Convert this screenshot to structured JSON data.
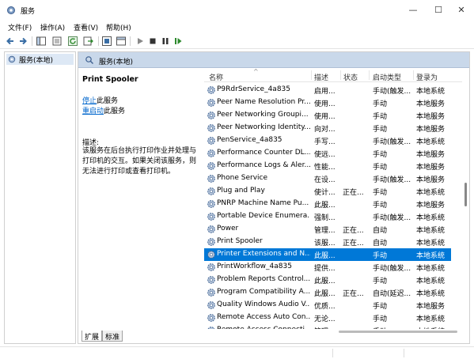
{
  "window": {
    "title": "服务",
    "minimize_glyph": "—",
    "maximize_glyph": "☐",
    "close_glyph": "✕"
  },
  "menu": [
    "文件(F)",
    "操作(A)",
    "查看(V)",
    "帮助(H)"
  ],
  "toolbar": {
    "icons": [
      "back-icon",
      "forward-icon",
      "show-console-tree-icon",
      "properties-icon",
      "refresh-icon",
      "export-list-icon",
      "help-icon",
      "start-service-icon",
      "stop-service-icon",
      "pause-service-icon",
      "restart-service-icon"
    ]
  },
  "tree": {
    "selected_label": "服务(本地)"
  },
  "pane": {
    "header_title": "服务(本地)"
  },
  "details": {
    "service_name": "Print Spooler",
    "stop_link": "停止",
    "stop_suffix": "此服务",
    "restart_link": "重启动",
    "restart_suffix": "此服务",
    "description_label": "描述:",
    "description_text": "该服务在后台执行打印作业并处理与打印机的交互。如果关闭该服务，则无法进行打印或查看打印机。"
  },
  "list": {
    "columns": [
      "名称",
      "描述",
      "状态",
      "启动类型",
      "登录为"
    ],
    "sort_indicator": "^",
    "selected_index": 13,
    "rows": [
      {
        "name": "P9RdrService_4a835",
        "desc": "启用...",
        "status": "",
        "start": "手动(触发...",
        "logon": "本地系统"
      },
      {
        "name": "Peer Name Resolution Pr...",
        "desc": "使用...",
        "status": "",
        "start": "手动",
        "logon": "本地服务"
      },
      {
        "name": "Peer Networking Groupi...",
        "desc": "使用...",
        "status": "",
        "start": "手动",
        "logon": "本地服务"
      },
      {
        "name": "Peer Networking Identity...",
        "desc": "向对...",
        "status": "",
        "start": "手动",
        "logon": "本地服务"
      },
      {
        "name": "PenService_4a835",
        "desc": "手写...",
        "status": "",
        "start": "手动(触发...",
        "logon": "本地系统"
      },
      {
        "name": "Performance Counter DL...",
        "desc": "使远...",
        "status": "",
        "start": "手动",
        "logon": "本地服务"
      },
      {
        "name": "Performance Logs & Aler...",
        "desc": "性能...",
        "status": "",
        "start": "手动",
        "logon": "本地服务"
      },
      {
        "name": "Phone Service",
        "desc": "在设...",
        "status": "",
        "start": "手动(触发...",
        "logon": "本地服务"
      },
      {
        "name": "Plug and Play",
        "desc": "使计...",
        "status": "正在...",
        "start": "手动",
        "logon": "本地系统"
      },
      {
        "name": "PNRP Machine Name Pu...",
        "desc": "此服...",
        "status": "",
        "start": "手动",
        "logon": "本地服务"
      },
      {
        "name": "Portable Device Enumera...",
        "desc": "强制...",
        "status": "",
        "start": "手动(触发...",
        "logon": "本地系统"
      },
      {
        "name": "Power",
        "desc": "管理...",
        "status": "正在...",
        "start": "自动",
        "logon": "本地系统"
      },
      {
        "name": "Print Spooler",
        "desc": "该服...",
        "status": "正在...",
        "start": "自动",
        "logon": "本地系统"
      },
      {
        "name": "Printer Extensions and N...",
        "desc": "此服...",
        "status": "",
        "start": "手动",
        "logon": "本地系统"
      },
      {
        "name": "PrintWorkflow_4a835",
        "desc": "提供...",
        "status": "",
        "start": "手动(触发...",
        "logon": "本地系统"
      },
      {
        "name": "Problem Reports Control...",
        "desc": "此服...",
        "status": "",
        "start": "手动",
        "logon": "本地系统"
      },
      {
        "name": "Program Compatibility A...",
        "desc": "此服...",
        "status": "正在...",
        "start": "自动(延迟...",
        "logon": "本地系统"
      },
      {
        "name": "Quality Windows Audio V...",
        "desc": "优质...",
        "status": "",
        "start": "手动",
        "logon": "本地服务"
      },
      {
        "name": "Remote Access Auto Con...",
        "desc": "无论...",
        "status": "",
        "start": "手动",
        "logon": "本地系统"
      },
      {
        "name": "Remote Access Connecti...",
        "desc": "管理...",
        "status": "",
        "start": "手动",
        "logon": "本地系统"
      }
    ]
  },
  "tabs": [
    "扩展",
    "标准"
  ],
  "colors": {
    "selection": "#0078d7",
    "pane_header": "#c9d8ea",
    "link": "#0066cc"
  }
}
